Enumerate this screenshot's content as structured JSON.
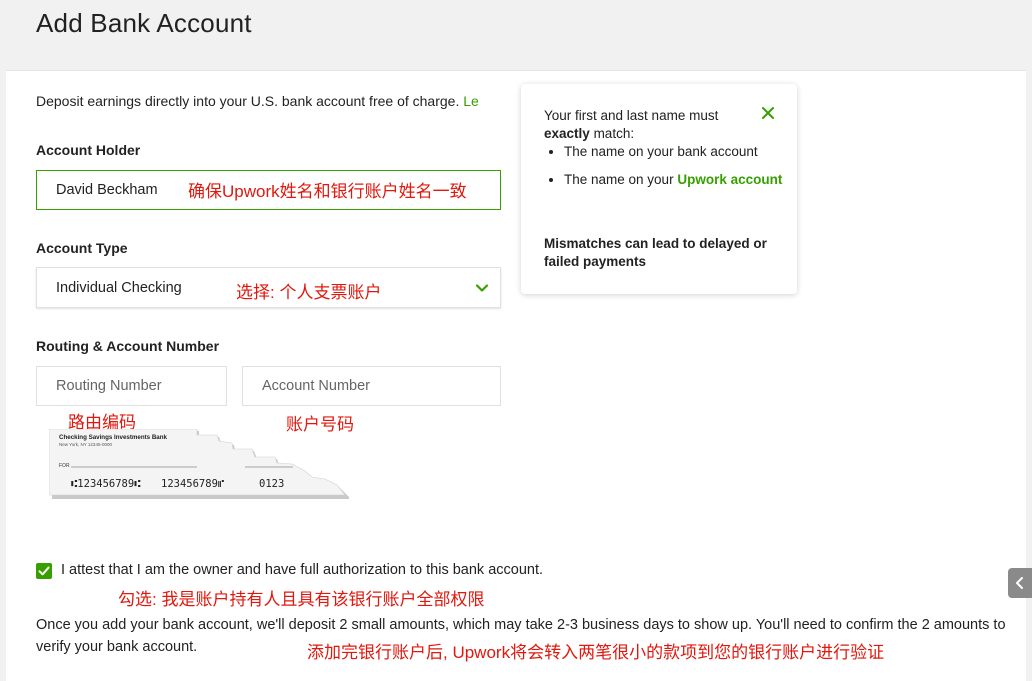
{
  "page": {
    "title": "Add Bank Account"
  },
  "intro": {
    "text": "Deposit earnings directly into your U.S. bank account free of charge.",
    "link": "Le"
  },
  "account_holder": {
    "label": "Account Holder",
    "value": "David Beckham",
    "note": "确保Upwork姓名和银行账户姓名一致"
  },
  "account_type": {
    "label": "Account Type",
    "selected": "Individual Checking",
    "note": "选择: 个人支票账户"
  },
  "routing_account": {
    "label": "Routing & Account Number",
    "routing_placeholder": "Routing Number",
    "account_placeholder": "Account Number",
    "routing_note": "路由编码",
    "account_note": "账户号码"
  },
  "cheque": {
    "bank_name": "Checking Savings Investments Bank",
    "bank_address": "New York, NY 12345-0000",
    "for_label": "FOR",
    "routing_digits": "⑆123456789⑆",
    "account_digits": "123456789⑈",
    "check_digits": "0123"
  },
  "tooltip": {
    "intro_1": "Your first and last name must",
    "intro_bold": "exactly",
    "intro_2": "match:",
    "bullet_1": "The name on your bank account",
    "bullet_2_prefix": "The name on your",
    "bullet_2_highlight": "Upwork account",
    "warning": "Mismatches can lead to delayed or failed payments"
  },
  "attest": {
    "checked": true,
    "text": "I attest that I am the owner and have full authorization to this bank account.",
    "note": "勾选: 我是账户持有人且具有该银行账户全部权限"
  },
  "deposit_info": {
    "text": "Once you add your bank account, we'll deposit 2 small amounts, which may take 2-3 business days to show up. You'll need to confirm the 2 amounts to verify your bank account.",
    "note": "添加完银行账户后, Upwork将会转入两笔很小的款项到您的银行账户进行验证"
  },
  "icons": {
    "close": "close-icon",
    "chevron": "chevron-down-icon",
    "check": "checkmark-icon",
    "side": "chevron-left-icon"
  },
  "colors": {
    "accent": "#37a000",
    "annotation": "#e0180e"
  }
}
